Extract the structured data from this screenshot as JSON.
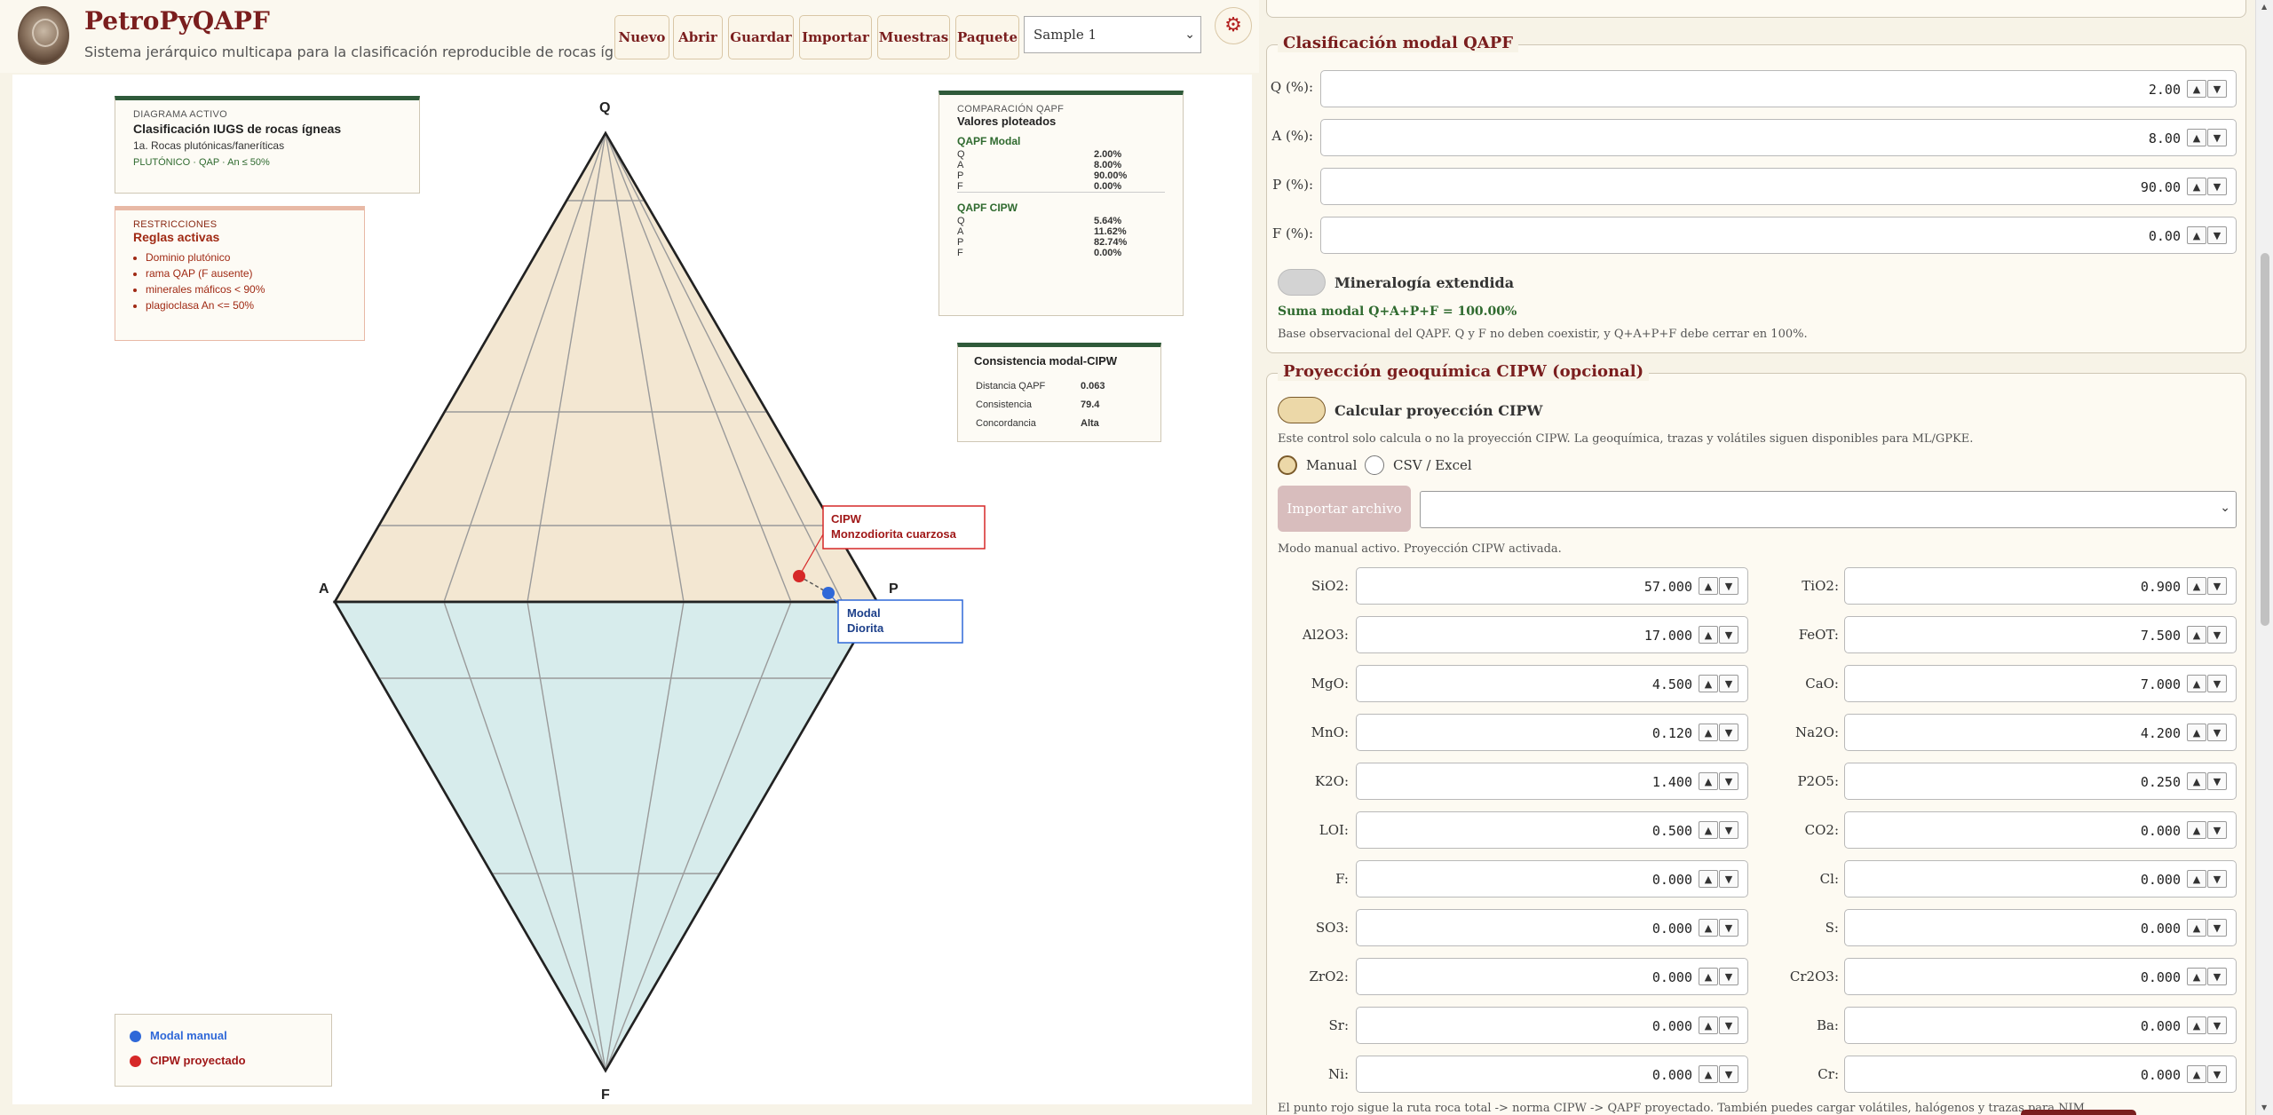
{
  "header": {
    "title": "PetroPyQAPF",
    "subtitle": "Sistema jerárquico multicapa para la clasificación reproducible de rocas ígneas.",
    "buttons": [
      "Nuevo",
      "Abrir",
      "Guardar",
      "Importar",
      "Muestras",
      "Paquete"
    ],
    "sample_select": "Sample 1",
    "settings_icon": "gear-icon"
  },
  "diagram": {
    "vertices": {
      "Q": "Q",
      "A": "A",
      "P": "P",
      "F": "F"
    },
    "active_card": {
      "kicker": "DIAGRAMA ACTIVO",
      "title": "Clasificación IUGS de rocas ígneas",
      "line": "1a. Rocas plutónicas/faneríticas",
      "tag": "PLUTÓNICO · QAP · An ≤ 50%"
    },
    "restrictions_card": {
      "kicker": "RESTRICCIONES",
      "title": "Reglas activas",
      "items": [
        "Dominio plutónico",
        "rama QAP (F ausente)",
        "minerales máficos < 90%",
        "plagioclasa An <= 50%"
      ]
    },
    "comparison_card": {
      "kicker": "COMPARACIÓN QAPF",
      "title": "Valores ploteados",
      "modal_title": "QAPF Modal",
      "modal_rows": [
        [
          "Q",
          "2.00%"
        ],
        [
          "A",
          "8.00%"
        ],
        [
          "P",
          "90.00%"
        ],
        [
          "F",
          "0.00%"
        ]
      ],
      "cipw_title": "QAPF CIPW",
      "cipw_rows": [
        [
          "Q",
          "5.64%"
        ],
        [
          "A",
          "11.62%"
        ],
        [
          "P",
          "82.74%"
        ],
        [
          "F",
          "0.00%"
        ]
      ]
    },
    "consistency_card": {
      "title": "Consistencia modal-CIPW",
      "rows": [
        [
          "Distancia QAPF",
          "0.063"
        ],
        [
          "Consistencia",
          "79.4"
        ],
        [
          "Concordancia",
          "Alta"
        ]
      ]
    },
    "labels": {
      "cipw_line1": "CIPW",
      "cipw_line2": "Monzodiorita cuarzosa",
      "modal_line1": "Modal",
      "modal_line2": "Diorita"
    },
    "legend": [
      "Modal manual",
      "CIPW proyectado"
    ],
    "colors": {
      "qap_fill": "#f3e7d2",
      "apf_fill": "#d7ecec",
      "modal": "#2f68d8",
      "cipw": "#d62828",
      "accent": "#7a1e1e"
    }
  },
  "qapf_modal": {
    "legend": "Clasificación modal QAPF",
    "fields": [
      {
        "label": "Q (%):",
        "value": "2.00"
      },
      {
        "label": "A (%):",
        "value": "8.00"
      },
      {
        "label": "P (%):",
        "value": "90.00"
      },
      {
        "label": "F (%):",
        "value": "0.00"
      }
    ],
    "extended_label": "Mineralogía extendida",
    "sum_text": "Suma modal Q+A+P+F = 100.00%",
    "base_note": "Base observacional del QAPF. Q y F no deben coexistir, y Q+A+P+F debe cerrar en 100%."
  },
  "cipw": {
    "legend": "Proyección geoquímica CIPW (opcional)",
    "toggle_label": "Calcular proyección CIPW",
    "note": "Este control solo calcula o no la proyección CIPW. La geoquímica, trazas y volátiles siguen disponibles para ML/GPKE.",
    "radio_manual": "Manual",
    "radio_csv": "CSV / Excel",
    "import_button": "Importar archivo",
    "status": "Modo manual activo. Proyección CIPW activada.",
    "oxides": [
      [
        {
          "label": "SiO2:",
          "value": "57.000"
        },
        {
          "label": "TiO2:",
          "value": "0.900"
        }
      ],
      [
        {
          "label": "Al2O3:",
          "value": "17.000"
        },
        {
          "label": "FeOT:",
          "value": "7.500"
        }
      ],
      [
        {
          "label": "MgO:",
          "value": "4.500"
        },
        {
          "label": "CaO:",
          "value": "7.000"
        }
      ],
      [
        {
          "label": "MnO:",
          "value": "0.120"
        },
        {
          "label": "Na2O:",
          "value": "4.200"
        }
      ],
      [
        {
          "label": "K2O:",
          "value": "1.400"
        },
        {
          "label": "P2O5:",
          "value": "0.250"
        }
      ],
      [
        {
          "label": "LOI:",
          "value": "0.500"
        },
        {
          "label": "CO2:",
          "value": "0.000"
        }
      ],
      [
        {
          "label": "F:",
          "value": "0.000"
        },
        {
          "label": "Cl:",
          "value": "0.000"
        }
      ],
      [
        {
          "label": "SO3:",
          "value": "0.000"
        },
        {
          "label": "S:",
          "value": "0.000"
        }
      ],
      [
        {
          "label": "ZrO2:",
          "value": "0.000"
        },
        {
          "label": "Cr2O3:",
          "value": "0.000"
        }
      ],
      [
        {
          "label": "Sr:",
          "value": "0.000"
        },
        {
          "label": "Ba:",
          "value": "0.000"
        }
      ],
      [
        {
          "label": "Ni:",
          "value": "0.000"
        },
        {
          "label": "Cr:",
          "value": "0.000"
        }
      ]
    ],
    "footer": "El punto rojo sigue la ruta roca total -> norma CIPW -> QAPF proyectado. También puedes cargar volátiles, halógenos y trazas para NIM."
  }
}
